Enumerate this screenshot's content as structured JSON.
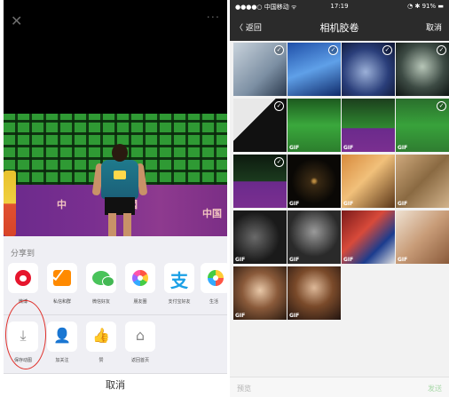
{
  "left_phone": {
    "close_icon": "close-icon",
    "more_icon": "more-dots-icon",
    "photo_banner_marks": [
      "中",
      "國",
      "中国"
    ],
    "share_title": "分享到",
    "share_targets": [
      {
        "label": "微博",
        "icon": "weibo-icon"
      },
      {
        "label": "私信和群",
        "icon": "mail-icon"
      },
      {
        "label": "微信好友",
        "icon": "wechat-icon"
      },
      {
        "label": "朋友圈",
        "icon": "moments-icon"
      },
      {
        "label": "支付宝好友",
        "icon": "alipay-icon"
      },
      {
        "label": "生活",
        "icon": "partial-icon"
      }
    ],
    "actions": [
      {
        "label": "保存动图",
        "icon": "download-icon",
        "glyph": "⤓"
      },
      {
        "label": "加关注",
        "icon": "add-follow-icon",
        "glyph": "👤"
      },
      {
        "label": "赞",
        "icon": "thumbs-up-icon",
        "glyph": "👍"
      },
      {
        "label": "返回首页",
        "icon": "home-icon",
        "glyph": "⌂"
      }
    ],
    "cancel_label": "取消",
    "highlight_color": "#e0302a"
  },
  "right_phone": {
    "status": {
      "carrier": "●●●●○ 中国移动 ᯤ",
      "time": "17:19",
      "battery": "◔ ✱ 91% ▬"
    },
    "nav": {
      "back_label": "〈 返回",
      "title": "相机胶卷",
      "cancel_label": "取消"
    },
    "gif_label": "GIF",
    "check_glyph": "✓",
    "footer": {
      "preview_label": "预览",
      "send_label": "发送"
    },
    "accent_color": "#a8d8a8",
    "thumbnails": [
      {
        "gif": false,
        "checked": true
      },
      {
        "gif": false,
        "checked": true
      },
      {
        "gif": false,
        "checked": true
      },
      {
        "gif": false,
        "checked": true
      },
      {
        "gif": false,
        "checked": true
      },
      {
        "gif": true,
        "checked": false
      },
      {
        "gif": true,
        "checked": false
      },
      {
        "gif": true,
        "checked": true
      },
      {
        "gif": false,
        "checked": true
      },
      {
        "gif": true,
        "checked": false
      },
      {
        "gif": true,
        "checked": false
      },
      {
        "gif": true,
        "checked": false
      },
      {
        "gif": true,
        "checked": false
      },
      {
        "gif": true,
        "checked": false
      },
      {
        "gif": true,
        "checked": false
      },
      {
        "gif": true,
        "checked": false
      },
      {
        "gif": true,
        "checked": false
      },
      {
        "gif": true,
        "checked": false
      }
    ]
  }
}
